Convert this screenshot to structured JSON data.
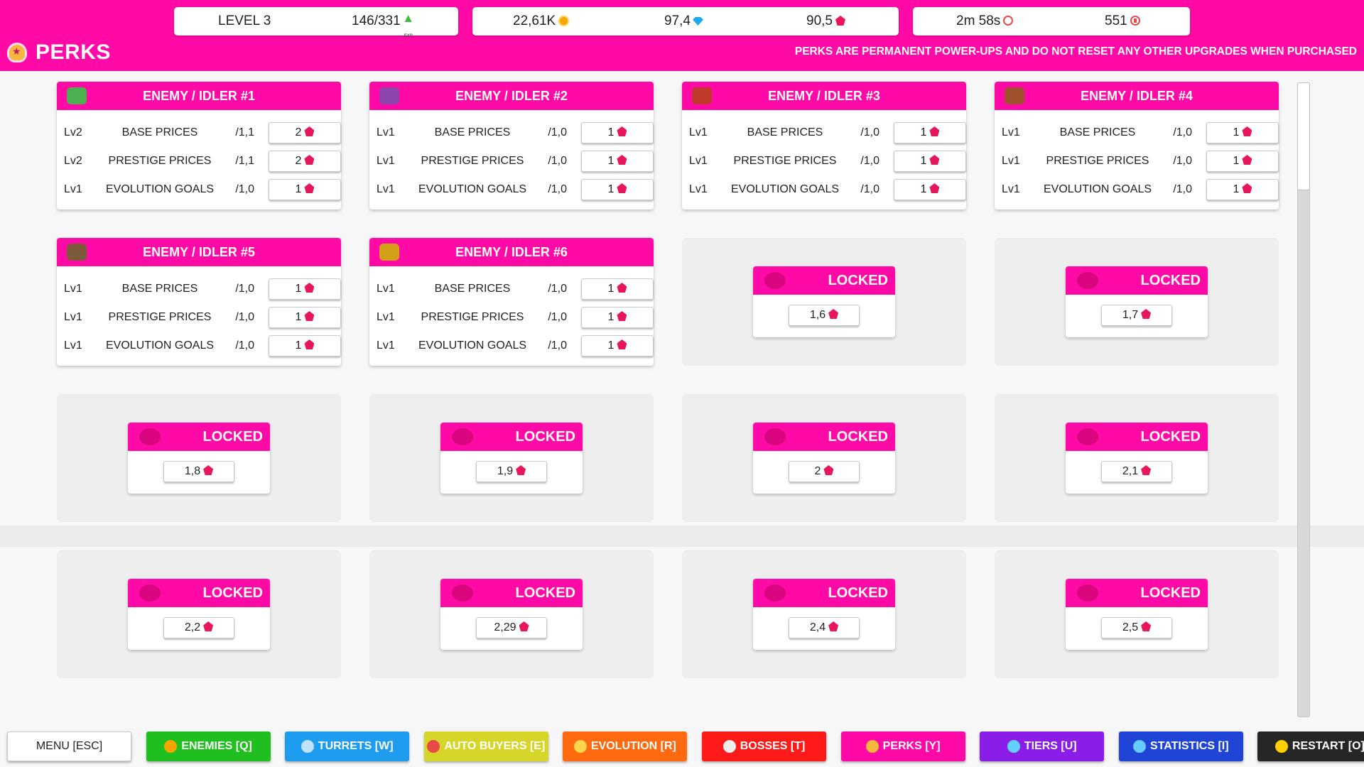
{
  "stats": {
    "level": "LEVEL 3",
    "exp": "146/331",
    "coins": "22,61K",
    "diamonds": "97,4",
    "gems": "90,5",
    "time": "2m 58s",
    "kills": "551"
  },
  "page": {
    "title": "PERKS",
    "note": "PERKS ARE PERMANENT POWER-UPS AND DO NOT RESET ANY OTHER UPGRADES WHEN PURCHASED"
  },
  "perks": [
    {
      "title": "ENEMY  /  IDLER #1",
      "icon_color": "#4caf50",
      "rows": [
        {
          "lv": "Lv2",
          "name": "BASE PRICES",
          "mult": "/1,1",
          "cost": "2"
        },
        {
          "lv": "Lv2",
          "name": "PRESTIGE PRICES",
          "mult": "/1,1",
          "cost": "2"
        },
        {
          "lv": "Lv1",
          "name": "EVOLUTION GOALS",
          "mult": "/1,0",
          "cost": "1"
        }
      ]
    },
    {
      "title": "ENEMY  /  IDLER #2",
      "icon_color": "#8e44ad",
      "rows": [
        {
          "lv": "Lv1",
          "name": "BASE PRICES",
          "mult": "/1,0",
          "cost": "1"
        },
        {
          "lv": "Lv1",
          "name": "PRESTIGE PRICES",
          "mult": "/1,0",
          "cost": "1"
        },
        {
          "lv": "Lv1",
          "name": "EVOLUTION GOALS",
          "mult": "/1,0",
          "cost": "1"
        }
      ]
    },
    {
      "title": "ENEMY  /  IDLER #3",
      "icon_color": "#c0392b",
      "rows": [
        {
          "lv": "Lv1",
          "name": "BASE PRICES",
          "mult": "/1,0",
          "cost": "1"
        },
        {
          "lv": "Lv1",
          "name": "PRESTIGE PRICES",
          "mult": "/1,0",
          "cost": "1"
        },
        {
          "lv": "Lv1",
          "name": "EVOLUTION GOALS",
          "mult": "/1,0",
          "cost": "1"
        }
      ]
    },
    {
      "title": "ENEMY  /  IDLER #4",
      "icon_color": "#a0522d",
      "rows": [
        {
          "lv": "Lv1",
          "name": "BASE PRICES",
          "mult": "/1,0",
          "cost": "1"
        },
        {
          "lv": "Lv1",
          "name": "PRESTIGE PRICES",
          "mult": "/1,0",
          "cost": "1"
        },
        {
          "lv": "Lv1",
          "name": "EVOLUTION GOALS",
          "mult": "/1,0",
          "cost": "1"
        }
      ]
    },
    {
      "title": "ENEMY  /  IDLER #5",
      "icon_color": "#7b5b3a",
      "rows": [
        {
          "lv": "Lv1",
          "name": "BASE PRICES",
          "mult": "/1,0",
          "cost": "1"
        },
        {
          "lv": "Lv1",
          "name": "PRESTIGE PRICES",
          "mult": "/1,0",
          "cost": "1"
        },
        {
          "lv": "Lv1",
          "name": "EVOLUTION GOALS",
          "mult": "/1,0",
          "cost": "1"
        }
      ]
    },
    {
      "title": "ENEMY  /  IDLER #6",
      "icon_color": "#d4a017",
      "rows": [
        {
          "lv": "Lv1",
          "name": "BASE PRICES",
          "mult": "/1,0",
          "cost": "1"
        },
        {
          "lv": "Lv1",
          "name": "PRESTIGE PRICES",
          "mult": "/1,0",
          "cost": "1"
        },
        {
          "lv": "Lv1",
          "name": "EVOLUTION GOALS",
          "mult": "/1,0",
          "cost": "1"
        }
      ]
    }
  ],
  "locked": [
    {
      "label": "LOCKED",
      "cost": "1,6"
    },
    {
      "label": "LOCKED",
      "cost": "1,7"
    },
    {
      "label": "LOCKED",
      "cost": "1,8"
    },
    {
      "label": "LOCKED",
      "cost": "1,9"
    },
    {
      "label": "LOCKED",
      "cost": "2"
    },
    {
      "label": "LOCKED",
      "cost": "2,1"
    },
    {
      "label": "LOCKED",
      "cost": "2,2"
    },
    {
      "label": "LOCKED",
      "cost": "2,29"
    },
    {
      "label": "LOCKED",
      "cost": "2,4"
    },
    {
      "label": "LOCKED",
      "cost": "2,5"
    }
  ],
  "nav": [
    {
      "label": "MENU [ESC]",
      "bg": "#ffffff",
      "fg": "#222222",
      "icon": "",
      "icon_color": ""
    },
    {
      "label": "ENEMIES [Q]",
      "bg": "#1fbf1f",
      "fg": "#ffffff",
      "icon": "coin-icon",
      "icon_color": "#f7a600"
    },
    {
      "label": "TURRETS [W]",
      "bg": "#1e9cf0",
      "fg": "#ffffff",
      "icon": "swords-icon",
      "icon_color": "#bfe3ff"
    },
    {
      "label": "AUTO BUYERS [E]",
      "bg": "#d6d62a",
      "fg": "#ffffff",
      "icon": "timer-icon",
      "icon_color": "#e84a4a"
    },
    {
      "label": "EVOLUTION [R]",
      "bg": "#ff6a10",
      "fg": "#ffffff",
      "icon": "star-icon",
      "icon_color": "#ffd54a"
    },
    {
      "label": "BOSSES [T]",
      "bg": "#ff1a1a",
      "fg": "#ffffff",
      "icon": "skull-icon",
      "icon_color": "#eeeeee"
    },
    {
      "label": "PERKS [Y]",
      "bg": "#ff0aa6",
      "fg": "#ffffff",
      "icon": "badge-icon",
      "icon_color": "#f6b73c"
    },
    {
      "label": "TIERS [U]",
      "bg": "#8a1ee8",
      "fg": "#ffffff",
      "icon": "pyramid-icon",
      "icon_color": "#5fd0ff"
    },
    {
      "label": "STATISTICS [I]",
      "bg": "#1f44d6",
      "fg": "#ffffff",
      "icon": "chart-icon",
      "icon_color": "#66ccff"
    },
    {
      "label": "RESTART [O]",
      "bg": "#262626",
      "fg": "#ffffff",
      "icon": "restart-icon",
      "icon_color": "#ffd000"
    }
  ]
}
